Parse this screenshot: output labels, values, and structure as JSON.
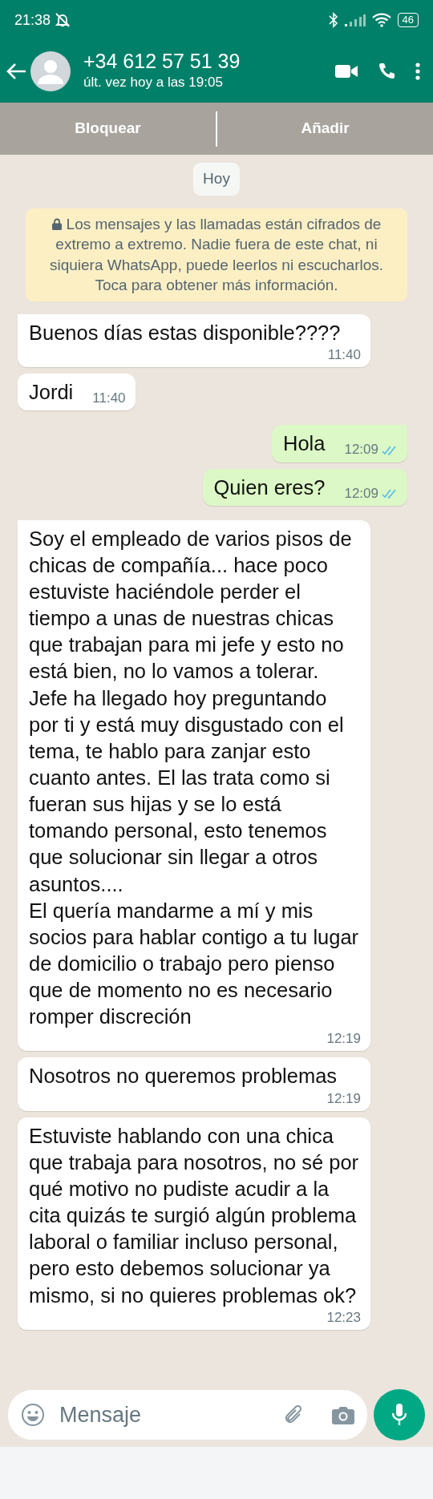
{
  "status_bar": {
    "time": "21:38",
    "battery": "46"
  },
  "header": {
    "title": "+34 612 57 51 39",
    "subtitle": "últ. vez hoy a las 19:05"
  },
  "action_bar": {
    "buttons": [
      "Bloquear",
      "Añadir"
    ]
  },
  "date_chip": "Hoy",
  "notice": "Los mensajes y las llamadas están cifrados de extremo a extremo. Nadie fuera de este chat, ni siquiera WhatsApp, puede leerlos ni escucharlos. Toca para obtener más información.",
  "messages": [
    {
      "kind": "incoming",
      "text": "Buenos días estas disponible????",
      "time": "11:40",
      "tail": true
    },
    {
      "kind": "incoming",
      "text": "Jordi",
      "time": "11:40",
      "tail": false
    },
    {
      "kind": "outgoing",
      "text": "Hola",
      "time": "12:09",
      "read": true,
      "tail": true
    },
    {
      "kind": "outgoing",
      "text": "Quien eres?",
      "time": "12:09",
      "read": true,
      "tail": false
    },
    {
      "kind": "incoming",
      "text": "Soy el empleado de varios pisos de chicas de compañía... hace poco estuviste haciéndole perder el tiempo a unas de nuestras chicas que trabajan para mi jefe y esto no está bien, no lo vamos a tolerar. Jefe ha llegado hoy preguntando por ti y está muy disgustado con el tema, te hablo para zanjar esto cuanto antes. El las trata como si fueran sus hijas y se lo está tomando personal, esto tenemos que solucionar sin llegar a otros asuntos....\nEl quería mandarme a mí y mis socios para hablar contigo a tu lugar de domicilio o trabajo pero pienso que de momento no es necesario romper discreción",
      "time": "12:19",
      "tail": true
    },
    {
      "kind": "incoming",
      "text": "Nosotros no queremos problemas",
      "time": "12:19",
      "tail": false
    },
    {
      "kind": "incoming",
      "text": "Estuviste hablando con una chica que trabaja para nosotros, no sé por qué motivo no pudiste acudir a la cita quizás te surgió algún problema laboral o familiar incluso personal, pero esto debemos solucionar ya mismo, si no quieres problemas ok?",
      "time": "12:23",
      "tail": false
    }
  ],
  "composer": {
    "placeholder": "Mensaje"
  }
}
